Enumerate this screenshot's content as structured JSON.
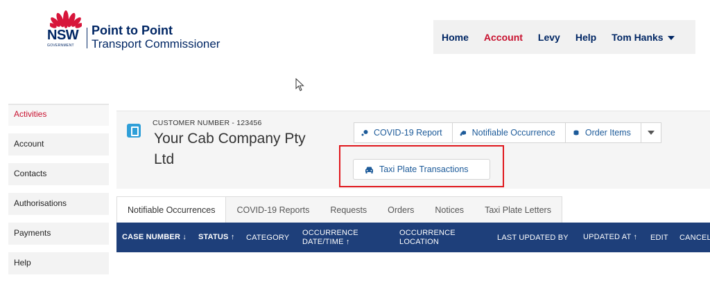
{
  "header": {
    "logo": {
      "nsw": "NSW",
      "government": "GOVERNMENT",
      "brand_line1": "Point to Point",
      "brand_line2": "Transport Commissioner"
    },
    "nav": [
      {
        "label": "Home",
        "active": false
      },
      {
        "label": "Account",
        "active": true
      },
      {
        "label": "Levy",
        "active": false
      },
      {
        "label": "Help",
        "active": false
      },
      {
        "label": "Tom Hanks",
        "active": false,
        "dropdown": true
      }
    ],
    "accent_color": "#c8102e",
    "brand_color": "#002664"
  },
  "sidebar": {
    "items": [
      {
        "label": "Activities",
        "active": true
      },
      {
        "label": "Account"
      },
      {
        "label": "Contacts"
      },
      {
        "label": "Authorisations"
      },
      {
        "label": "Payments"
      },
      {
        "label": "Help"
      }
    ]
  },
  "record": {
    "customer_number": "CUSTOMER NUMBER - 123456",
    "company_name": "Your Cab Company Pty Ltd",
    "actions": [
      {
        "label": "COVID-19 Report",
        "icon": "covid-report-icon"
      },
      {
        "label": "Notifiable Occurrence",
        "icon": "notifiable-occurrence-icon"
      },
      {
        "label": "Order Items",
        "icon": "order-items-icon"
      }
    ],
    "taxi_plate_button": {
      "label": "Taxi Plate Transactions",
      "icon": "car-icon"
    }
  },
  "tabs": [
    {
      "label": "Notifiable Occurrences",
      "active": true
    },
    {
      "label": "COVID-19 Reports"
    },
    {
      "label": "Requests"
    },
    {
      "label": "Orders"
    },
    {
      "label": "Notices"
    },
    {
      "label": "Taxi Plate Letters"
    }
  ],
  "table": {
    "columns": [
      {
        "label": "CASE NUMBER ↓",
        "bold": true
      },
      {
        "label": "STATUS ↑",
        "bold": true
      },
      {
        "label": "CATEGORY"
      },
      {
        "label": "OCCURRENCE DATE/TIME ↑"
      },
      {
        "label": "OCCURRENCE LOCATION"
      },
      {
        "label": "LAST UPDATED BY"
      },
      {
        "label": "UPDATED AT ↑"
      },
      {
        "label": "EDIT"
      },
      {
        "label": "CANCEL"
      }
    ],
    "header_color": "#1e3f7a"
  }
}
